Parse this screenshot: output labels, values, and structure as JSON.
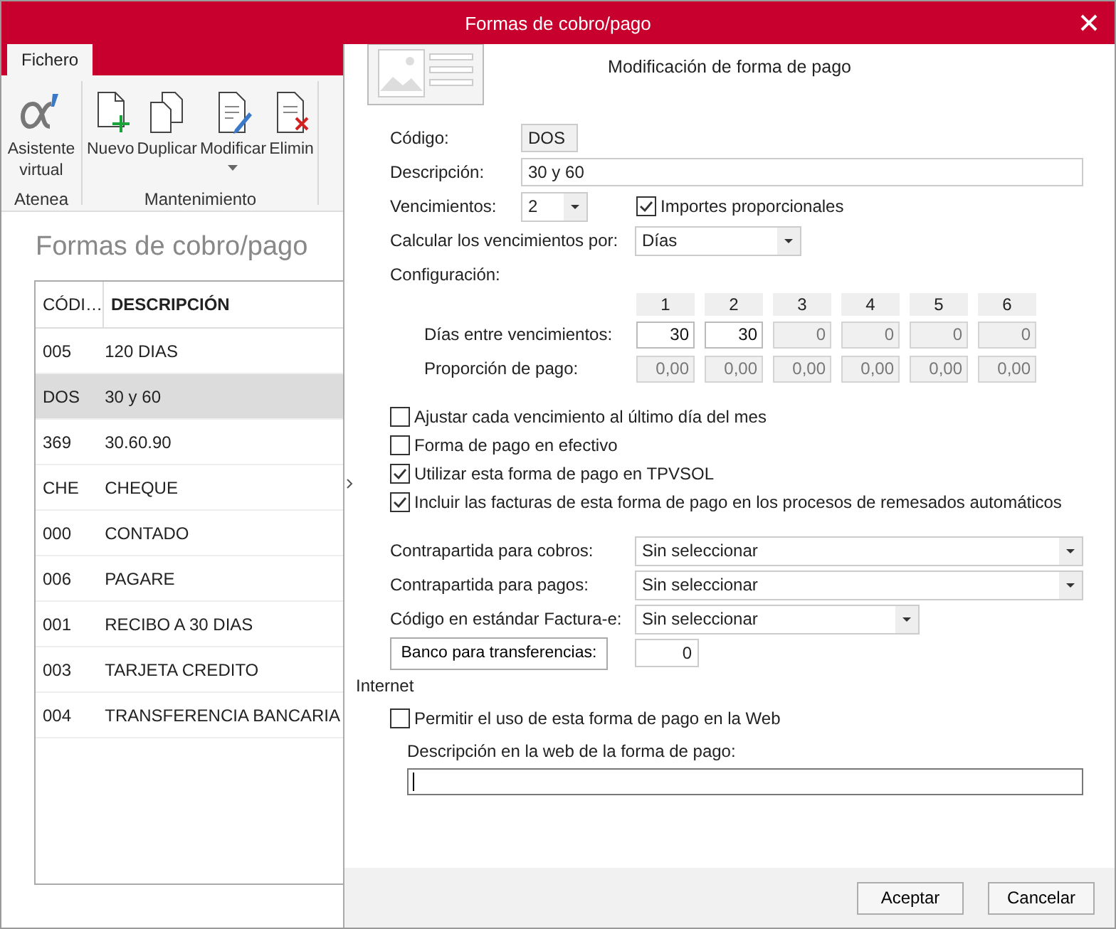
{
  "window": {
    "title": "Formas de cobro/pago"
  },
  "ribbon": {
    "tabs": [
      {
        "label": "Fichero",
        "selected": true
      }
    ],
    "groups": [
      {
        "label": "Atenea",
        "buttons": [
          {
            "label": "Asistente virtual",
            "kind": "alpha",
            "dropdown": false
          }
        ]
      },
      {
        "label": "Mantenimiento",
        "buttons": [
          {
            "label": "Nuevo",
            "kind": "new",
            "dropdown": false
          },
          {
            "label": "Duplicar",
            "kind": "copy",
            "dropdown": false
          },
          {
            "label": "Modificar",
            "kind": "edit",
            "dropdown": true
          },
          {
            "label": "Elimin",
            "kind": "delete",
            "dropdown": false
          }
        ]
      }
    ]
  },
  "list": {
    "heading": "Formas de cobro/pago",
    "columns": [
      "CÓDI…",
      "DESCRIPCIÓN"
    ],
    "rows": [
      {
        "code": "005",
        "description": "120 DIAS",
        "selected": false
      },
      {
        "code": "DOS",
        "description": "30 y 60",
        "selected": true
      },
      {
        "code": "369",
        "description": "30.60.90",
        "selected": false
      },
      {
        "code": "CHE",
        "description": "CHEQUE",
        "selected": false
      },
      {
        "code": "000",
        "description": "CONTADO",
        "selected": false
      },
      {
        "code": "006",
        "description": "PAGARE",
        "selected": false
      },
      {
        "code": "001",
        "description": "RECIBO A 30 DIAS",
        "selected": false
      },
      {
        "code": "003",
        "description": "TARJETA CREDITO",
        "selected": false
      },
      {
        "code": "004",
        "description": "TRANSFERENCIA BANCARIA",
        "selected": false
      }
    ]
  },
  "dialog": {
    "title": "Modificación de forma de pago",
    "codigo": {
      "label": "Código:",
      "value": "DOS"
    },
    "descripcion": {
      "label": "Descripción:",
      "value": "30 y 60"
    },
    "vencimientos": {
      "label": "Vencimientos:",
      "value": "2"
    },
    "importes": {
      "label": "Importes proporcionales",
      "checked": true
    },
    "calcular": {
      "label": "Calcular los vencimientos por:",
      "value": "Días"
    },
    "configuracion": {
      "label": "Configuración:",
      "columns": [
        "1",
        "2",
        "3",
        "4",
        "5",
        "6"
      ],
      "rows": [
        {
          "label": "Días entre vencimientos:",
          "cells": [
            {
              "value": "30",
              "disabled": false
            },
            {
              "value": "30",
              "disabled": false
            },
            {
              "value": "0",
              "disabled": true
            },
            {
              "value": "0",
              "disabled": true
            },
            {
              "value": "0",
              "disabled": true
            },
            {
              "value": "0",
              "disabled": true
            }
          ]
        },
        {
          "label": "Proporción de pago:",
          "cells": [
            {
              "value": "0,00",
              "disabled": true
            },
            {
              "value": "0,00",
              "disabled": true
            },
            {
              "value": "0,00",
              "disabled": true
            },
            {
              "value": "0,00",
              "disabled": true
            },
            {
              "value": "0,00",
              "disabled": true
            },
            {
              "value": "0,00",
              "disabled": true
            }
          ]
        }
      ]
    },
    "options": [
      {
        "label": "Ajustar cada vencimiento al último día del mes",
        "checked": false
      },
      {
        "label": "Forma de pago en efectivo",
        "checked": false
      },
      {
        "label": "Utilizar esta forma de pago en TPVSOL",
        "checked": true
      },
      {
        "label": "Incluir las facturas de esta forma de pago en los procesos de remesados automáticos",
        "checked": true
      }
    ],
    "selects": [
      {
        "label": "Contrapartida para cobros:",
        "value": "Sin seleccionar",
        "wide": true
      },
      {
        "label": "Contrapartida para pagos:",
        "value": "Sin seleccionar",
        "wide": true
      },
      {
        "label": "Código en estándar Factura-e:",
        "value": "Sin seleccionar",
        "wide": false
      }
    ],
    "banco": {
      "button": "Banco para transferencias:",
      "value": "0"
    },
    "internet": {
      "label": "Internet",
      "permitir": {
        "label": "Permitir el uso de esta forma de pago en la Web",
        "checked": false
      },
      "web_label": "Descripción en la web de la forma de pago:"
    },
    "buttons": [
      "Aceptar",
      "Cancelar"
    ]
  }
}
